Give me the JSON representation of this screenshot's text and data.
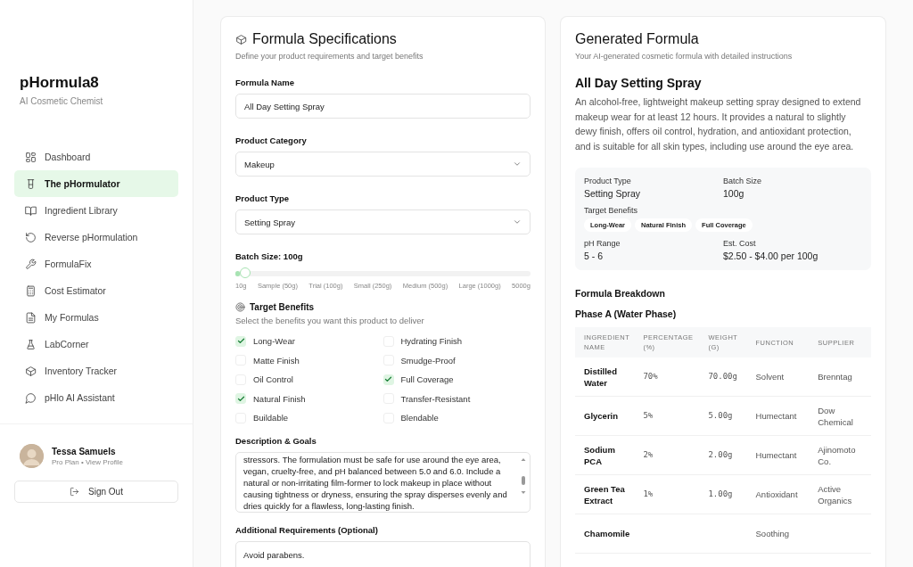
{
  "sidebar": {
    "brand": "pHormula8",
    "tagline": "AI Cosmetic Chemist",
    "items": [
      {
        "label": "Dashboard",
        "selected": false
      },
      {
        "label": "The pHormulator",
        "selected": true
      },
      {
        "label": "Ingredient Library",
        "selected": false
      },
      {
        "label": "Reverse pHormulation",
        "selected": false
      },
      {
        "label": "FormulaFix",
        "selected": false
      },
      {
        "label": "Cost Estimator",
        "selected": false
      },
      {
        "label": "My Formulas",
        "selected": false
      },
      {
        "label": "LabCorner",
        "selected": false
      },
      {
        "label": "Inventory Tracker",
        "selected": false
      },
      {
        "label": "pHlo AI Assistant",
        "selected": false
      }
    ],
    "user": {
      "name": "Tessa Samuels",
      "plan": "Pro Plan • View Profile"
    },
    "sign_out": "Sign Out"
  },
  "specs": {
    "title": "Formula Specifications",
    "subtitle": "Define your product requirements and target benefits",
    "fields": [
      {
        "kind": "text",
        "label": "Formula Name",
        "value": "All Day Setting Spray"
      },
      {
        "kind": "select",
        "label": "Product Category",
        "value": "Makeup"
      },
      {
        "kind": "select",
        "label": "Product Type",
        "value": "Setting Spray"
      }
    ],
    "batch": {
      "label": "Batch Size: 100g",
      "level": 0.035,
      "ticks": [
        "10g",
        "Sample (50g)",
        "Trial (100g)",
        "Small (250g)",
        "Medium (500g)",
        "Large (1000g)",
        "5000g"
      ]
    },
    "benefits": {
      "title": "Target Benefits",
      "subtitle": "Select the benefits you want this product to deliver",
      "options": [
        {
          "label": "Long-Wear",
          "checked": true
        },
        {
          "label": "Hydrating Finish",
          "checked": false
        },
        {
          "label": "Matte Finish",
          "checked": false
        },
        {
          "label": "Smudge-Proof",
          "checked": false
        },
        {
          "label": "Oil Control",
          "checked": false
        },
        {
          "label": "Full Coverage",
          "checked": true
        },
        {
          "label": "Natural Finish",
          "checked": true
        },
        {
          "label": "Transfer-Resistant",
          "checked": false
        },
        {
          "label": "Buildable",
          "checked": false
        },
        {
          "label": "Blendable",
          "checked": false
        }
      ]
    },
    "description": {
      "label": "Description & Goals",
      "value": "stressors. The formulation must be safe for use around the eye area, vegan, cruelty-free, and pH balanced between 5.0 and 6.0. Include a natural or non-irritating film-former to lock makeup in place without causing tightness or dryness, ensuring the spray disperses evenly and dries quickly for a flawless, long-lasting finish."
    },
    "additional": {
      "label": "Additional Requirements (Optional)",
      "value": "Avoid parabens."
    }
  },
  "result": {
    "title": "Generated Formula",
    "subtitle": "Your AI-generated cosmetic formula with detailed instructions",
    "name": "All Day Setting Spray",
    "summary": "An alcohol-free, lightweight makeup setting spray designed to extend makeup wear for at least 12 hours. It provides a natural to slightly dewy finish, offers oil control, hydration, and antioxidant protection, and is suitable for all skin types, including use around the eye area.",
    "info": {
      "product_type": {
        "label": "Product Type",
        "value": "Setting Spray"
      },
      "batch_size": {
        "label": "Batch Size",
        "value": "100g"
      },
      "target_benefits": {
        "label": "Target Benefits",
        "tags": [
          "Long-Wear",
          "Natural Finish",
          "Full Coverage"
        ]
      },
      "ph_range": {
        "label": "pH Range",
        "value": "5 - 6"
      },
      "est_cost": {
        "label": "Est. Cost",
        "value": "$2.50 - $4.00 per 100g"
      }
    },
    "breakdown_title": "Formula Breakdown",
    "phase_title": "Phase A (Water Phase)",
    "table": {
      "columns": [
        "INGREDIENT NAME",
        "PERCENTAGE (%)",
        "WEIGHT (G)",
        "FUNCTION",
        "SUPPLIER"
      ],
      "rows": [
        [
          "Distilled Water",
          "70%",
          "70.00g",
          "Solvent",
          "Brenntag"
        ],
        [
          "Glycerin",
          "5%",
          "5.00g",
          "Humectant",
          "Dow Chemical"
        ],
        [
          "Sodium PCA",
          "2%",
          "2.00g",
          "Humectant",
          "Ajinomoto Co."
        ],
        [
          "Green Tea Extract",
          "1%",
          "1.00g",
          "Antioxidant",
          "Active Organics"
        ],
        [
          "Chamomile",
          "",
          "",
          "Soothing",
          ""
        ]
      ]
    }
  }
}
